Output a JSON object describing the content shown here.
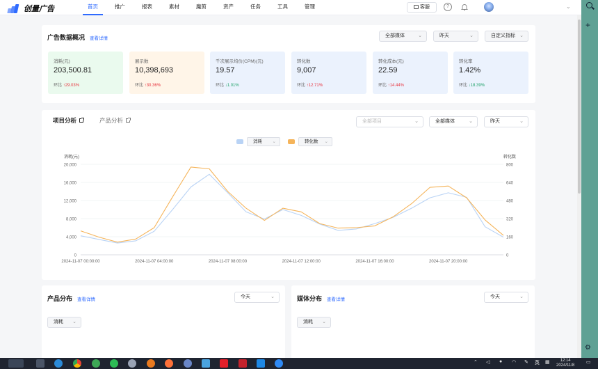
{
  "brand": {
    "name": "创量广告"
  },
  "nav": [
    "首页",
    "推广",
    "报表",
    "素材",
    "魔剪",
    "资产",
    "任务",
    "工具",
    "管理"
  ],
  "header": {
    "kefu_label": "客服"
  },
  "overview": {
    "title": "广告数据概况",
    "detail_link": "查看详情",
    "filters": [
      "全部媒体",
      "昨天",
      "自定义指标"
    ],
    "compare_prefix": "环比",
    "stats": [
      {
        "label": "消耗(元)",
        "value": "203,500.81",
        "change": "29.03%",
        "dir": "up",
        "bg": "#eafaee"
      },
      {
        "label": "展示数",
        "value": "10,398,693",
        "change": "30.36%",
        "dir": "up",
        "bg": "#fff5e8"
      },
      {
        "label": "千次展示均价(CPM)(元)",
        "value": "19.57",
        "change": "1.01%",
        "dir": "down",
        "bg": "#ebf2fd"
      },
      {
        "label": "转化数",
        "value": "9,007",
        "change": "12.71%",
        "dir": "up",
        "bg": "#ebf2fd"
      },
      {
        "label": "转化成本(元)",
        "value": "22.59",
        "change": "14.44%",
        "dir": "up",
        "bg": "#ebf2fd"
      },
      {
        "label": "转化率",
        "value": "1.42%",
        "change": "18.39%",
        "dir": "down",
        "bg": "#ebf2fd"
      }
    ]
  },
  "analysis": {
    "tabs": [
      "项目分析",
      "产品分析"
    ],
    "filters": [
      "全部项目",
      "全部媒体",
      "昨天"
    ],
    "legend": [
      {
        "label": "消耗",
        "color": "#b9d3f5"
      },
      {
        "label": "转化数",
        "color": "#f5b45a"
      }
    ]
  },
  "chart_data": {
    "type": "line",
    "xlabel": "",
    "left_axis_title": "消耗(元)",
    "right_axis_title": "转化数",
    "ylim_left": [
      0,
      20000
    ],
    "ylim_right": [
      0,
      800
    ],
    "yticks_left": [
      "0",
      "4,000",
      "8,000",
      "12,000",
      "16,000",
      "20,000"
    ],
    "yticks_right": [
      "0",
      "160",
      "320",
      "480",
      "640",
      "800"
    ],
    "x": [
      0,
      1,
      2,
      3,
      4,
      5,
      6,
      7,
      8,
      9,
      10,
      11,
      12,
      13,
      14,
      15,
      16,
      17,
      18,
      19,
      20,
      21,
      22,
      23
    ],
    "x_tick_labels": [
      {
        "x": 0,
        "label": "2024-11-07 00:00:00"
      },
      {
        "x": 4,
        "label": "2024-11-07 04:00:00"
      },
      {
        "x": 8,
        "label": "2024-11-07 08:00:00"
      },
      {
        "x": 12,
        "label": "2024-11-07 12:00:00"
      },
      {
        "x": 16,
        "label": "2024-11-07 16:00:00"
      },
      {
        "x": 20,
        "label": "2024-11-07 20:00:00"
      }
    ],
    "grid": true,
    "series": [
      {
        "name": "消耗",
        "axis": "left",
        "color": "#b9d3f5",
        "values": [
          4200,
          3400,
          2600,
          3100,
          5200,
          10000,
          15000,
          17800,
          13700,
          9500,
          7900,
          10000,
          8700,
          6800,
          5400,
          5700,
          6900,
          8300,
          10300,
          12600,
          13700,
          12700,
          6200,
          3900
        ]
      },
      {
        "name": "转化数",
        "axis": "left",
        "color": "#f5b45a",
        "values": [
          5300,
          3900,
          2800,
          3500,
          6000,
          12800,
          19400,
          19000,
          14000,
          10300,
          7600,
          10300,
          9500,
          6900,
          5900,
          6000,
          6400,
          8400,
          11300,
          14900,
          15200,
          12600,
          7700,
          4300
        ]
      }
    ]
  },
  "product_dist": {
    "title": "产品分布",
    "detail_link": "查看详情",
    "period": "今天",
    "metric": "消耗"
  },
  "media_dist": {
    "title": "媒体分布",
    "detail_link": "查看详情",
    "period": "今天",
    "metric": "消耗"
  },
  "taskbar": {
    "tray_lang": "英",
    "clock_time": "12:14",
    "clock_date": "2024/11/8"
  }
}
